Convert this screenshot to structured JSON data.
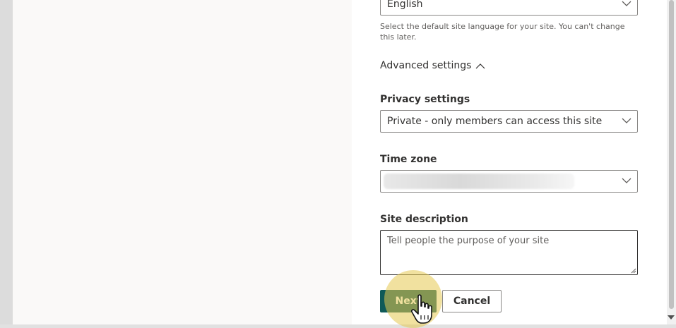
{
  "language": {
    "value": "English",
    "hint": "Select the default site language for your site. You can't change this later."
  },
  "advanced": {
    "label": "Advanced settings",
    "icon": "chevron-up-icon"
  },
  "privacy": {
    "label": "Privacy settings",
    "value": "Private - only members can access this site"
  },
  "timezone": {
    "label": "Time zone",
    "value_blurred": true
  },
  "description": {
    "label": "Site description",
    "placeholder": "Tell people the purpose of your site"
  },
  "actions": {
    "next_label": "Next",
    "cancel_label": "Cancel"
  },
  "colors": {
    "primary": "#0f5a58",
    "click_highlight": "#e6c850"
  }
}
